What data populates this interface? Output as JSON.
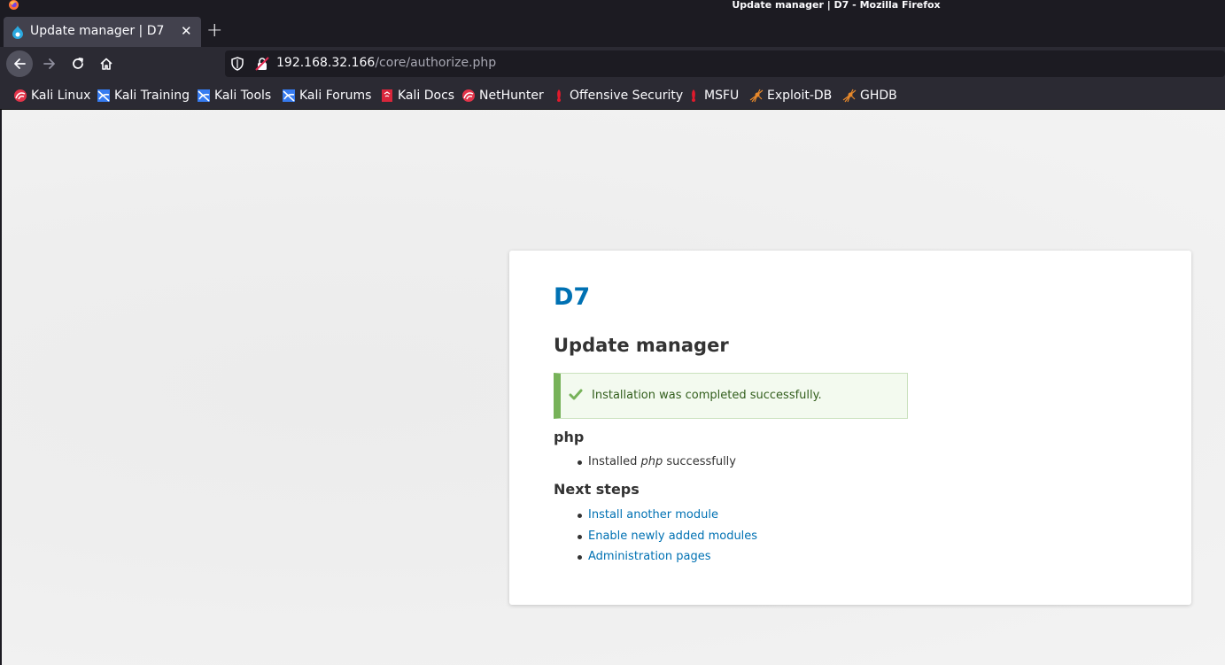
{
  "window": {
    "title": "Update manager | D7 - Mozilla Firefox"
  },
  "tab": {
    "title": "Update manager | D7",
    "close": "✕",
    "new_tab": "+"
  },
  "url": {
    "host": "192.168.32.166",
    "path": "/core/authorize.php"
  },
  "bookmarks": [
    {
      "label": "Kali Linux",
      "icon": "kali-red-icon"
    },
    {
      "label": "Kali Training",
      "icon": "kali-blue-icon"
    },
    {
      "label": "Kali Tools",
      "icon": "kali-blue-icon"
    },
    {
      "label": "Kali Forums",
      "icon": "kali-blue-icon"
    },
    {
      "label": "Kali Docs",
      "icon": "kali-docs-icon"
    },
    {
      "label": "NetHunter",
      "icon": "kali-red-icon"
    },
    {
      "label": "Offensive Security",
      "icon": "offsec-icon"
    },
    {
      "label": "MSFU",
      "icon": "offsec-icon"
    },
    {
      "label": "Exploit-DB",
      "icon": "exploitdb-spider-icon"
    },
    {
      "label": "GHDB",
      "icon": "exploitdb-spider-icon"
    }
  ],
  "page": {
    "site_name": "D7",
    "title": "Update manager",
    "status_message": "Installation was completed successfully.",
    "php_heading": "php",
    "php_item_prefix": "Installed ",
    "php_item_em": "php",
    "php_item_suffix": " successfully",
    "next_heading": "Next steps",
    "next_links": [
      "Install another module",
      "Enable newly added modules",
      "Administration pages"
    ]
  },
  "colors": {
    "link": "#0071b3",
    "status_green": "#77b259",
    "status_bg": "#f3faef"
  }
}
